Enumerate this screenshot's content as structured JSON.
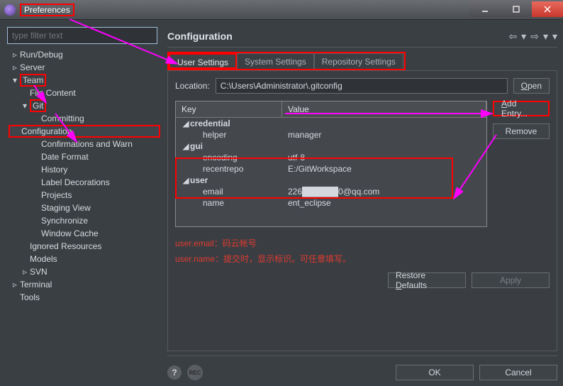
{
  "window": {
    "title": "Preferences"
  },
  "search": {
    "placeholder": "type filter text"
  },
  "tree": {
    "items": [
      {
        "label": "Run/Debug",
        "depth": 0,
        "expand": "▹"
      },
      {
        "label": "Server",
        "depth": 0,
        "expand": "▹"
      },
      {
        "label": "Team",
        "depth": 0,
        "expand": "▾",
        "boxed": true
      },
      {
        "label": "File Content",
        "depth": 1,
        "expand": ""
      },
      {
        "label": "Git",
        "depth": 1,
        "expand": "▾",
        "boxed": true
      },
      {
        "label": "Committing",
        "depth": 2,
        "expand": ""
      },
      {
        "label": "Configuration",
        "depth": 2,
        "expand": "",
        "selected": true
      },
      {
        "label": "Confirmations and Warn",
        "depth": 2,
        "expand": ""
      },
      {
        "label": "Date Format",
        "depth": 2,
        "expand": ""
      },
      {
        "label": "History",
        "depth": 2,
        "expand": ""
      },
      {
        "label": "Label Decorations",
        "depth": 2,
        "expand": ""
      },
      {
        "label": "Projects",
        "depth": 2,
        "expand": ""
      },
      {
        "label": "Staging View",
        "depth": 2,
        "expand": ""
      },
      {
        "label": "Synchronize",
        "depth": 2,
        "expand": ""
      },
      {
        "label": "Window Cache",
        "depth": 2,
        "expand": ""
      },
      {
        "label": "Ignored Resources",
        "depth": 1,
        "expand": ""
      },
      {
        "label": "Models",
        "depth": 1,
        "expand": ""
      },
      {
        "label": "SVN",
        "depth": 1,
        "expand": "▹"
      },
      {
        "label": "Terminal",
        "depth": 0,
        "expand": "▹"
      },
      {
        "label": "Tools",
        "depth": 0,
        "expand": ""
      }
    ]
  },
  "page": {
    "heading": "Configuration",
    "tabs": [
      "User Settings",
      "System Settings",
      "Repository Settings"
    ],
    "active_tab": 0,
    "location_label": "Location:",
    "location_value": "C:\\Users\\Administrator\\.gitconfig",
    "open": "Open",
    "columns": {
      "key": "Key",
      "value": "Value"
    },
    "entries": [
      {
        "type": "group",
        "key": "credential"
      },
      {
        "type": "kv",
        "key": "helper",
        "value": "manager"
      },
      {
        "type": "group",
        "key": "gui"
      },
      {
        "type": "kv",
        "key": "encoding",
        "value": "utf-8"
      },
      {
        "type": "kv",
        "key": "recentrepo",
        "value": "E:/GitWorkspace"
      },
      {
        "type": "group",
        "key": "user"
      },
      {
        "type": "kv",
        "key": "email",
        "value": "226██████0@qq.com"
      },
      {
        "type": "kv",
        "key": "name",
        "value": "ent_eclipse"
      }
    ],
    "add_entry": "Add Entry...",
    "remove": "Remove",
    "restore": "Restore Defaults",
    "apply": "Apply"
  },
  "annotation": {
    "line1_key": "user.email：",
    "line1_val": "码云帐号",
    "line2_key": "user.name：",
    "line2_val": "提交时，显示标识。可任意填写。"
  },
  "dialog": {
    "ok": "OK",
    "cancel": "Cancel"
  }
}
